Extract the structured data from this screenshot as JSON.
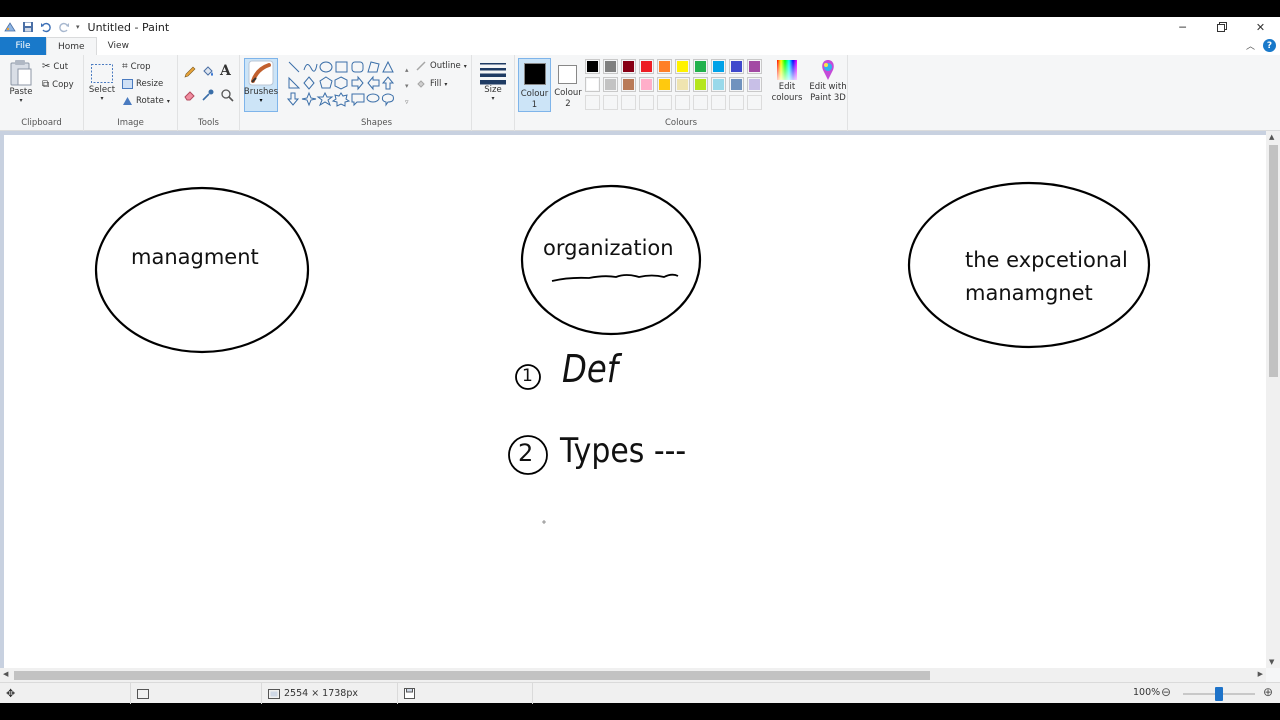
{
  "window": {
    "title": "Untitled - Paint"
  },
  "tabs": {
    "file": "File",
    "home": "Home",
    "view": "View"
  },
  "ribbon": {
    "clipboard": {
      "paste": "Paste",
      "cut": "Cut",
      "copy": "Copy",
      "label": "Clipboard"
    },
    "image": {
      "select": "Select",
      "crop": "Crop",
      "resize": "Resize",
      "rotate": "Rotate",
      "label": "Image"
    },
    "tools": {
      "label": "Tools"
    },
    "brushes": {
      "label": "Brushes"
    },
    "shapes": {
      "outline": "Outline",
      "fill": "Fill",
      "label": "Shapes"
    },
    "size": {
      "label": "Size"
    },
    "colours": {
      "colour1": "Colour 1",
      "colour2": "Colour 2",
      "edit": "Edit colours",
      "paint3d": "Edit with Paint 3D",
      "label": "Colours",
      "colour1_value": "#000000",
      "colour2_value": "#ffffff",
      "palette_row1": [
        "#000000",
        "#7f7f7f",
        "#880015",
        "#ed1c24",
        "#ff7f27",
        "#fff200",
        "#22b14c",
        "#00a2e8",
        "#3f48cc",
        "#a349a4"
      ],
      "palette_row2": [
        "#ffffff",
        "#c3c3c3",
        "#b97a57",
        "#ffaec9",
        "#ffc90e",
        "#efe4b0",
        "#b5e61d",
        "#99d9ea",
        "#7092be",
        "#c8bfe7"
      ]
    }
  },
  "canvas": {
    "text_management": "managment",
    "text_organization": "organization",
    "text_exceptional_1": "the expcetional",
    "text_exceptional_2": "manamgnet",
    "hand_1": "1",
    "hand_def": "Def",
    "hand_2": "2",
    "hand_types": "Types ---"
  },
  "status": {
    "dimensions": "2554 × 1738px",
    "zoom": "100%",
    "zoom_level": 100
  }
}
